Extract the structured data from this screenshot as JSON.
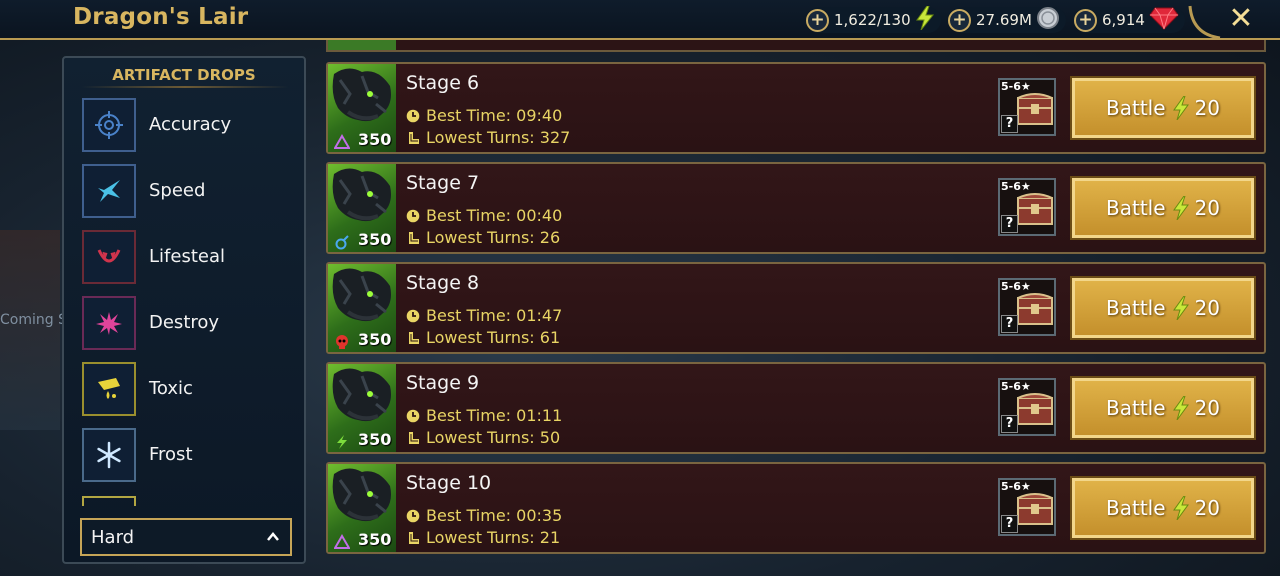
{
  "header": {
    "title": "Dragon's Lair",
    "resources": [
      {
        "name": "energy",
        "value": "1,622/130",
        "icon": "lightning-icon"
      },
      {
        "name": "silver",
        "value": "27.69M",
        "icon": "silver-coin-icon"
      },
      {
        "name": "gems",
        "value": "6,914",
        "icon": "ruby-icon"
      }
    ],
    "close_icon": "close-icon"
  },
  "sidebar": {
    "heading": "ARTIFACT DROPS",
    "sets": [
      {
        "label": "Accuracy",
        "icon": "crosshair-icon",
        "color": "#4a82c9"
      },
      {
        "label": "Speed",
        "icon": "speed-bird-icon",
        "color": "#4ac1e6"
      },
      {
        "label": "Lifesteal",
        "icon": "fangs-icon",
        "color": "#d0344c"
      },
      {
        "label": "Destroy",
        "icon": "burst-icon",
        "color": "#e0449a"
      },
      {
        "label": "Toxic",
        "icon": "poison-icon",
        "color": "#e7d33a"
      },
      {
        "label": "Frost",
        "icon": "snowflake-icon",
        "color": "#9fd3ff"
      }
    ],
    "difficulty": {
      "value": "Hard"
    }
  },
  "background": {
    "peek_text": "Coming S"
  },
  "stages": [
    {
      "name": "Stage 6",
      "power": "350",
      "affinity": "force",
      "best_time": "Best Time: 09:40",
      "lowest_turns": "Lowest Turns: 327",
      "reward_rank": "5-6★",
      "battle_label": "Battle",
      "battle_cost": "20"
    },
    {
      "name": "Stage 7",
      "power": "350",
      "affinity": "magic",
      "best_time": "Best Time: 00:40",
      "lowest_turns": "Lowest Turns: 26",
      "reward_rank": "5-6★",
      "battle_label": "Battle",
      "battle_cost": "20"
    },
    {
      "name": "Stage 8",
      "power": "350",
      "affinity": "void",
      "best_time": "Best Time: 01:47",
      "lowest_turns": "Lowest Turns: 61",
      "reward_rank": "5-6★",
      "battle_label": "Battle",
      "battle_cost": "20"
    },
    {
      "name": "Stage 9",
      "power": "350",
      "affinity": "spirit",
      "best_time": "Best Time: 01:11",
      "lowest_turns": "Lowest Turns: 50",
      "reward_rank": "5-6★",
      "battle_label": "Battle",
      "battle_cost": "20"
    },
    {
      "name": "Stage 10",
      "power": "350",
      "affinity": "force",
      "best_time": "Best Time: 00:35",
      "lowest_turns": "Lowest Turns: 21",
      "reward_rank": "5-6★",
      "battle_label": "Battle",
      "battle_cost": "20"
    }
  ],
  "reward_unknown": "?",
  "colors": {
    "gold": "#d8b660",
    "stat_yellow": "#e9d565",
    "panel_border": "#7a6540",
    "stage_bg": "#2c1415"
  }
}
